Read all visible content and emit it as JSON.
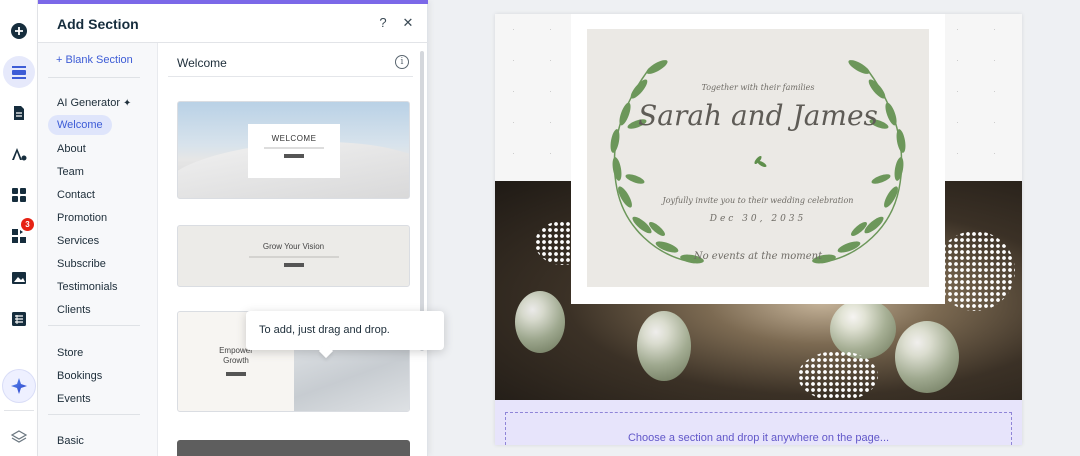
{
  "panel": {
    "title": "Add Section",
    "help_icon": "?",
    "close_icon": "✕"
  },
  "rail": {
    "items": [
      "add-icon",
      "sections-icon",
      "pages-icon",
      "design-icon",
      "apps-icon",
      "business-apps-icon",
      "media-icon",
      "cms-icon",
      "ai-assistant-icon",
      "layers-icon"
    ],
    "badge": "3"
  },
  "categories": {
    "blank_section": "+ Blank Section",
    "group1": [
      "AI Generator",
      "Welcome",
      "About",
      "Team",
      "Contact",
      "Promotion",
      "Services",
      "Subscribe",
      "Testimonials",
      "Clients"
    ],
    "group2": [
      "Store",
      "Bookings",
      "Events"
    ],
    "group3": [
      "Basic"
    ],
    "selected": "Welcome"
  },
  "content": {
    "title": "Welcome",
    "info_icon": "i",
    "thumbs": {
      "t1_heading": "WELCOME",
      "t2_heading": "Grow Your Vision",
      "t3_heading_line1": "Empower",
      "t3_heading_line2": "Growth"
    },
    "tooltip": "To add, just drag and drop."
  },
  "site": {
    "together": "Together with their families",
    "names": "Sarah and James",
    "invite": "Joyfully invite you to their wedding celebration",
    "date": "Dec 30, 2035",
    "no_events": "No events at the moment",
    "drop_hint": "Choose a section and drop it anywhere on the page..."
  },
  "colors": {
    "accent": "#3d5cd6",
    "purple": "#7b68e8",
    "badge": "#e62214"
  }
}
